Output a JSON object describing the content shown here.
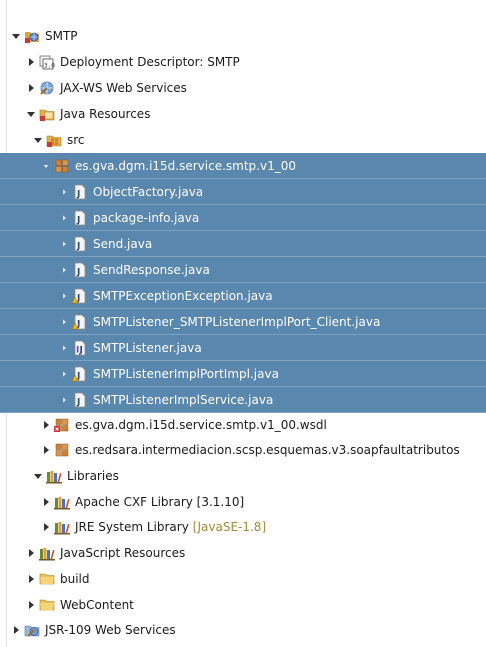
{
  "tree": [
    {
      "id": "smtp",
      "label": "SMTP",
      "icon": "web-project-icon",
      "toggle": "expanded",
      "level": 0,
      "selected": false
    },
    {
      "id": "deployment",
      "label": "Deployment Descriptor: SMTP",
      "icon": "deployment-descriptor-icon",
      "toggle": "collapsed",
      "level": 1,
      "selected": false
    },
    {
      "id": "jaxws",
      "label": "JAX-WS Web Services",
      "icon": "web-services-icon",
      "toggle": "collapsed",
      "level": 1,
      "selected": false
    },
    {
      "id": "javares",
      "label": "Java Resources",
      "icon": "java-resources-icon",
      "toggle": "expanded",
      "level": 1,
      "selected": false
    },
    {
      "id": "src",
      "label": "src",
      "icon": "source-folder-icon",
      "toggle": "expanded",
      "level": 2,
      "selected": false
    },
    {
      "id": "pkg",
      "label": "es.gva.dgm.i15d.service.smtp.v1_00",
      "icon": "package-icon",
      "toggle": "expanded-small",
      "level": 3,
      "selected": true
    },
    {
      "id": "objfactory",
      "label": "ObjectFactory.java",
      "icon": "java-file-icon",
      "toggle": "collapsed-small",
      "level": 4,
      "selected": true
    },
    {
      "id": "pkginfo",
      "label": "package-info.java",
      "icon": "java-file-icon",
      "toggle": "collapsed-small",
      "level": 4,
      "selected": true
    },
    {
      "id": "send",
      "label": "Send.java",
      "icon": "java-file-icon",
      "toggle": "collapsed-small",
      "level": 4,
      "selected": true
    },
    {
      "id": "sendresp",
      "label": "SendResponse.java",
      "icon": "java-file-icon",
      "toggle": "collapsed-small",
      "level": 4,
      "selected": true
    },
    {
      "id": "smtpex",
      "label": "SMTPExceptionException.java",
      "icon": "java-file-warning-icon",
      "toggle": "collapsed-small",
      "level": 4,
      "selected": true
    },
    {
      "id": "smtpclient",
      "label": "SMTPListener_SMTPListenerImplPort_Client.java",
      "icon": "java-file-warning-icon",
      "toggle": "collapsed-small",
      "level": 4,
      "selected": true
    },
    {
      "id": "smtplistener",
      "label": "SMTPListener.java",
      "icon": "java-interface-icon",
      "toggle": "collapsed-small",
      "level": 4,
      "selected": true
    },
    {
      "id": "smtpimpl",
      "label": "SMTPListenerImplPortImpl.java",
      "icon": "java-file-warning-icon",
      "toggle": "collapsed-small",
      "level": 4,
      "selected": true
    },
    {
      "id": "smtpservice",
      "label": "SMTPListenerImplService.java",
      "icon": "java-file-icon",
      "toggle": "collapsed-small",
      "level": 4,
      "selected": true
    },
    {
      "id": "wsdlpkg",
      "label": "es.gva.dgm.i15d.service.smtp.v1_00.wsdl",
      "icon": "package-error-icon",
      "toggle": "collapsed",
      "level": 3,
      "selected": false
    },
    {
      "id": "redsara",
      "label": "es.redsara.intermediacion.scsp.esquemas.v3.soapfaultatributos",
      "icon": "package-icon",
      "toggle": "collapsed",
      "level": 3,
      "selected": false
    },
    {
      "id": "libraries",
      "label": "Libraries",
      "icon": "library-icon",
      "toggle": "expanded",
      "level": 2,
      "selected": false
    },
    {
      "id": "cxf",
      "label": "Apache CXF Library [3.1.10]",
      "icon": "library-icon",
      "toggle": "collapsed",
      "level": 3,
      "selected": false
    },
    {
      "id": "jre",
      "label": "JRE System Library",
      "decoration": "[JavaSE-1.8]",
      "icon": "library-icon",
      "toggle": "collapsed",
      "level": 3,
      "selected": false
    },
    {
      "id": "jsres",
      "label": "JavaScript Resources",
      "icon": "library-icon",
      "toggle": "collapsed",
      "level": 1,
      "selected": false
    },
    {
      "id": "build",
      "label": "build",
      "icon": "folder-icon",
      "toggle": "collapsed",
      "level": 1,
      "selected": false
    },
    {
      "id": "webcontent",
      "label": "WebContent",
      "icon": "folder-icon",
      "toggle": "collapsed",
      "level": 1,
      "selected": false
    },
    {
      "id": "jsr109",
      "label": "JSR-109 Web Services",
      "icon": "jsr-web-services-icon",
      "toggle": "collapsed",
      "level": 0,
      "selected": false
    }
  ]
}
